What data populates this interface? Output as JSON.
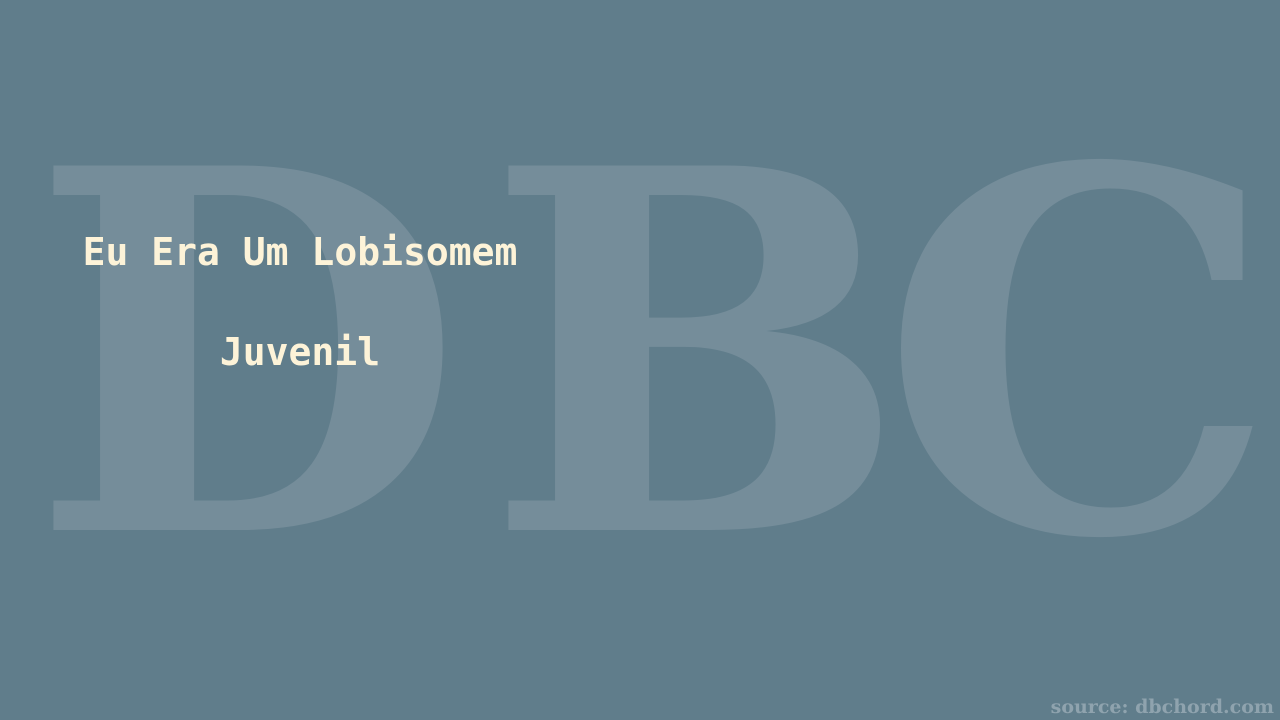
{
  "watermark": "DBC",
  "title": {
    "line1": "Eu Era Um Lobisomem",
    "line2": "Juvenil"
  },
  "source": "source: dbchord.com",
  "colors": {
    "background": "#607d8b",
    "title": "#fdf3d8",
    "watermark": "#758d9a"
  }
}
